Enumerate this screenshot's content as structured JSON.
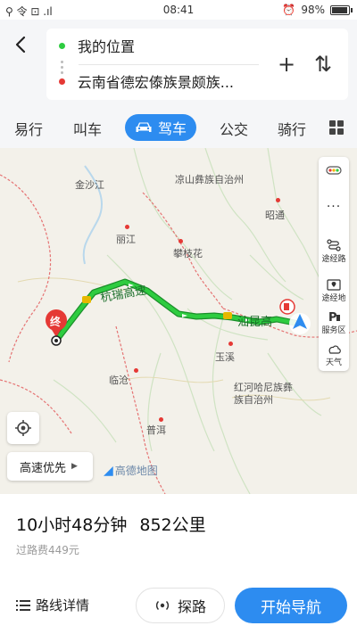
{
  "status_bar": {
    "left_icons": "⚲ 令 ⊡ .ıl",
    "time": "08:41",
    "alarm_icon": "alarm-icon",
    "battery": "98%",
    "battery_level": 0.98
  },
  "header": {
    "start_point": "我的位置",
    "destination": "云南省德宏傣族景颇族...",
    "add_stop_icon": "+",
    "swap_icon": "⇅"
  },
  "tabs": {
    "items": [
      "易行",
      "叫车",
      "驾车",
      "公交",
      "骑行"
    ],
    "active": "驾车"
  },
  "map": {
    "labels": {
      "jinshajiang": "金沙江",
      "liangshan": "凉山彝族自治州",
      "zhaotong": "昭通",
      "lijiang": "丽江",
      "panzhihua": "攀枝花",
      "hangrui": "杭瑞高速",
      "shankun": "汕昆高",
      "yuxi": "玉溪",
      "lincang": "临沧",
      "honghe": "红河哈尼族彝族自治州",
      "puer": "普洱",
      "liu": "六"
    },
    "end_marker": "终",
    "route_color": "#2ecc40",
    "province_border_color": "#e57373"
  },
  "side_panel": {
    "route_label": "途经路",
    "via_label": "途经地",
    "service_label": "服务区",
    "weather_label": "天气"
  },
  "controls": {
    "preference": "高速优先",
    "logo": "高德地图"
  },
  "summary": {
    "duration": "10小时48分钟",
    "distance": "852公里",
    "toll": "过路费449元"
  },
  "actions": {
    "route_detail": "路线详情",
    "explore": "探路",
    "start_nav": "开始导航"
  },
  "colors": {
    "accent": "#2d8cf0",
    "route": "#2ecc40"
  }
}
